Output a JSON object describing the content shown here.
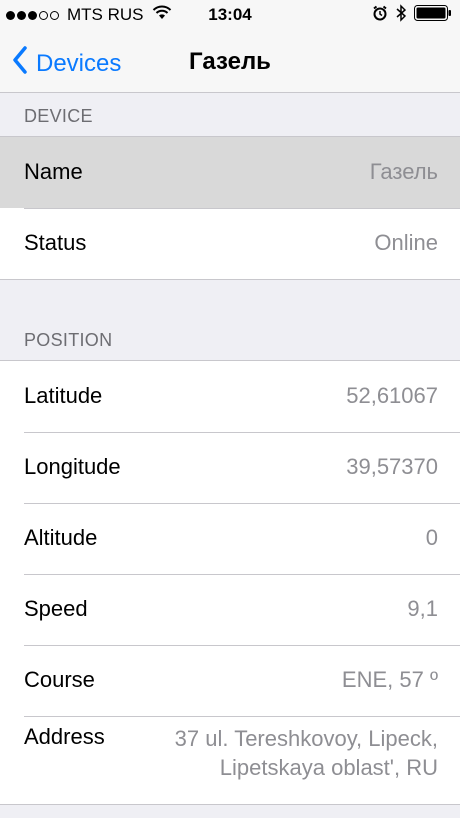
{
  "status_bar": {
    "carrier": "MTS RUS",
    "time": "13:04",
    "signal_bars_filled": 3,
    "signal_bars_total": 5
  },
  "nav": {
    "back_label": "Devices",
    "title": "Газель"
  },
  "device_section": {
    "header": "DEVICE",
    "rows": [
      {
        "label": "Name",
        "value": "Газель"
      },
      {
        "label": "Status",
        "value": "Online"
      }
    ]
  },
  "position_section": {
    "header": "POSITION",
    "rows": [
      {
        "label": "Latitude",
        "value": "52,61067"
      },
      {
        "label": "Longitude",
        "value": "39,57370"
      },
      {
        "label": "Altitude",
        "value": "0"
      },
      {
        "label": "Speed",
        "value": "9,1"
      },
      {
        "label": "Course",
        "value": "ENE, 57 º"
      },
      {
        "label": "Address",
        "value_line1": "37 ul. Tereshkovoy, Lipeck,",
        "value_line2": "Lipetskaya oblast', RU"
      }
    ]
  },
  "colors": {
    "accent": "#0a7aff",
    "background": "#efeff4",
    "secondary_text": "#8e8e93",
    "selected_row": "#d9d9d9"
  }
}
